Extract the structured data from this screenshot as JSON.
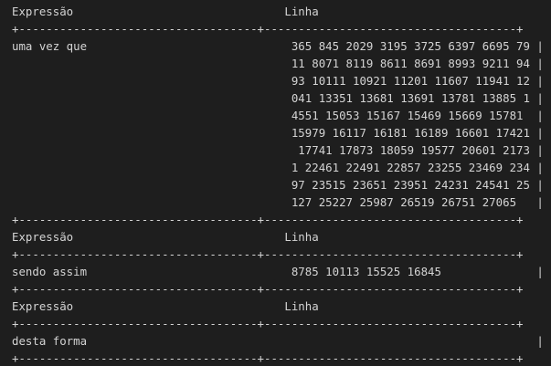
{
  "terminal": {
    "lines": [
      "Expressão                               Linha                                   |",
      "+-----------------------------------+-------------------------------------+",
      "uma vez que                              365 845 2029 3195 3725 6397 6695 79 |",
      "                                         11 8071 8119 8611 8691 8993 9211 94 |",
      "                                         93 10111 10921 11201 11607 11941 12 |",
      "                                         041 13351 13681 13691 13781 13885 1 |",
      "                                         4551 15053 15167 15469 15669 15781  |",
      "                                         15979 16117 16181 16189 16601 17421 |",
      "                                          17741 17873 18059 19577 20601 2173 |",
      "                                         1 22461 22491 22857 23255 23469 234 |",
      "                                         97 23515 23651 23951 24231 24541 25 |",
      "                                         127 25227 25987 26519 26751 27065   |",
      "+-----------------------------------+-------------------------------------+",
      "Expressão                               Linha                                   |",
      "+-----------------------------------+-------------------------------------+",
      "sendo assim                              8785 10113 15525 16845              |",
      "+-----------------------------------+-------------------------------------+",
      "Expressão                               Linha                                   |",
      "+-----------------------------------+-------------------------------------+",
      "desta forma                                                                  |",
      "+-----------------------------------+-------------------------------------+"
    ]
  }
}
